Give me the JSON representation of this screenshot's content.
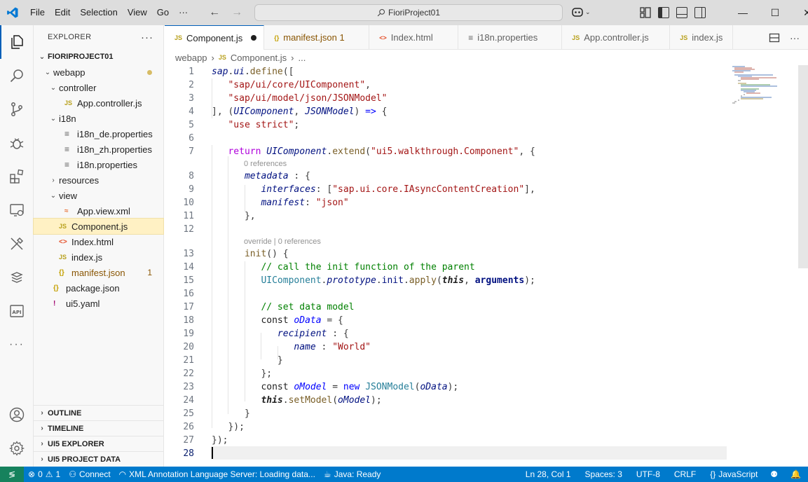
{
  "titlebar": {
    "menu": [
      "File",
      "Edit",
      "Selection",
      "View",
      "Go"
    ],
    "menu_more": "···",
    "search_text": "FioriProject01"
  },
  "sidebar": {
    "header": "EXPLORER",
    "more": "···",
    "root": "FIORIPROJECT01",
    "tree": [
      {
        "label": "webapp",
        "icon": "folder",
        "level": 1,
        "chev": "⌄",
        "dot": true
      },
      {
        "label": "controller",
        "icon": "folder",
        "level": 2,
        "chev": "⌄"
      },
      {
        "label": "App.controller.js",
        "icon": "js",
        "level": 3
      },
      {
        "label": "i18n",
        "icon": "folder",
        "level": 2,
        "chev": "⌄"
      },
      {
        "label": "i18n_de.properties",
        "icon": "properties",
        "level": 3
      },
      {
        "label": "i18n_zh.properties",
        "icon": "properties",
        "level": 3
      },
      {
        "label": "i18n.properties",
        "icon": "properties",
        "level": 3
      },
      {
        "label": "resources",
        "icon": "folder",
        "level": 2,
        "chev": "›"
      },
      {
        "label": "view",
        "icon": "folder",
        "level": 2,
        "chev": "⌄"
      },
      {
        "label": "App.view.xml",
        "icon": "xml",
        "level": 3
      },
      {
        "label": "Component.js",
        "icon": "js",
        "level": 2,
        "selected": true
      },
      {
        "label": "Index.html",
        "icon": "html",
        "level": 2
      },
      {
        "label": "index.js",
        "icon": "js",
        "level": 2
      },
      {
        "label": "manifest.json",
        "icon": "json",
        "level": 2,
        "badge": "1"
      },
      {
        "label": "package.json",
        "icon": "json",
        "level": 1
      },
      {
        "label": "ui5.yaml",
        "icon": "yaml",
        "level": 1
      }
    ],
    "sections": [
      "OUTLINE",
      "TIMELINE",
      "UI5 EXPLORER",
      "UI5 PROJECT DATA"
    ]
  },
  "tabs": [
    {
      "label": "Component.js",
      "icon": "JS",
      "active": true,
      "modified": true
    },
    {
      "label": "manifest.json 1",
      "icon": "{}"
    },
    {
      "label": "Index.html",
      "icon": "<>"
    },
    {
      "label": "i18n.properties",
      "icon": "≡"
    },
    {
      "label": "App.controller.js",
      "icon": "JS"
    },
    {
      "label": "index.js",
      "icon": "JS"
    }
  ],
  "breadcrumb": {
    "folder": "webapp",
    "file": "Component.js",
    "more": "..."
  },
  "editor": {
    "line_numbers": [
      "1",
      "2",
      "3",
      "4",
      "5",
      "6",
      "7",
      "8",
      "9",
      "10",
      "11",
      "12",
      "13",
      "14",
      "15",
      "16",
      "17",
      "18",
      "19",
      "20",
      "21",
      "22",
      "23",
      "24",
      "25",
      "26",
      "27",
      "28"
    ],
    "codelens": [
      "0 references",
      "override | 0 references"
    ],
    "cursor_line": 28
  },
  "statusbar": {
    "problems_errors": "0",
    "problems_warnings": "1",
    "connect": "Connect",
    "language_server": "XML Annotation Language Server: Loading data...",
    "java": "Java: Ready",
    "position": "Ln 28, Col 1",
    "spaces": "Spaces: 3",
    "encoding": "UTF-8",
    "eol": "CRLF",
    "language": "JavaScript"
  }
}
